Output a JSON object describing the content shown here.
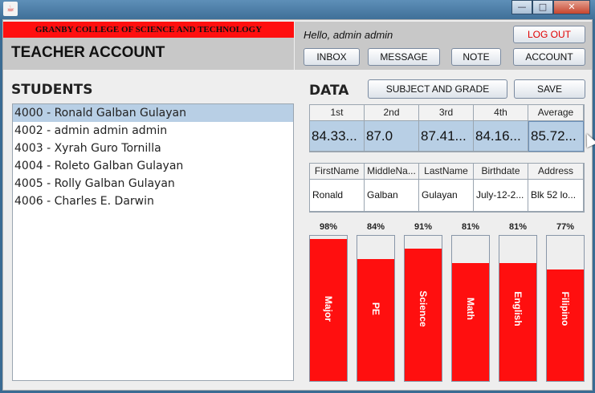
{
  "window": {
    "icon": "java-icon",
    "controls": {
      "minimize": "—",
      "maximize": "□",
      "close": "✕"
    }
  },
  "header": {
    "college": "GRANBY COLLEGE OF SCIENCE AND TECHNOLOGY",
    "title": "TEACHER ACCOUNT",
    "greeting": "Hello, admin admin",
    "logout_label": "LOG OUT",
    "nav": [
      "INBOX",
      "MESSAGE",
      "NOTE",
      "ACCOUNT"
    ]
  },
  "students": {
    "title": "STUDENTS",
    "items": [
      "4000 - Ronald Galban Gulayan",
      "4002 - admin admin admin",
      "4003 - Xyrah Guro Tornilla",
      "4004 - Roleto Galban Gulayan",
      "4005 - Rolly Galban Gulayan",
      "4006 - Charles E. Darwin"
    ],
    "selected_index": 0
  },
  "data": {
    "title": "DATA",
    "subject_grade_label": "SUBJECT AND GRADE",
    "save_label": "SAVE",
    "grades": {
      "headers": [
        "1st",
        "2nd",
        "3rd",
        "4th",
        "Average"
      ],
      "values": [
        "84.33...",
        "87.0",
        "87.41...",
        "84.16...",
        "85.72..."
      ]
    },
    "info": {
      "headers": [
        "FirstName",
        "MiddleNa...",
        "LastName",
        "Birthdate",
        "Address"
      ],
      "values": [
        "Ronald",
        "Galban",
        "Gulayan",
        "July-12-2...",
        "Blk 52 lo..."
      ]
    },
    "subjects": [
      {
        "name": "Major",
        "percent_label": "98%",
        "level": 0.98
      },
      {
        "name": "PE",
        "percent_label": "84%",
        "level": 0.84
      },
      {
        "name": "Science",
        "percent_label": "91%",
        "level": 0.91
      },
      {
        "name": "Math",
        "percent_label": "81%",
        "level": 0.81
      },
      {
        "name": "English",
        "percent_label": "81%",
        "level": 0.81
      },
      {
        "name": "Filipino",
        "percent_label": "77%",
        "level": 0.77
      }
    ]
  },
  "colors": {
    "accent_red": "#ff0f0f",
    "selection_blue": "#b8cfe5",
    "panel_gray": "#c8c8c8"
  }
}
